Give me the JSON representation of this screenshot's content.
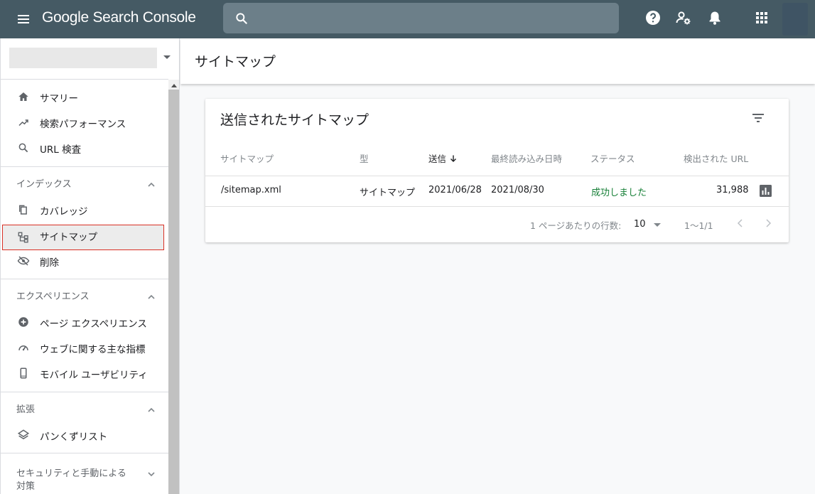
{
  "app": {
    "brand": "Google Search Console",
    "search_placeholder": ""
  },
  "sidebar": {
    "property_value": "",
    "items": [
      {
        "label": "サマリー",
        "icon": "home-icon"
      },
      {
        "label": "検索パフォーマンス",
        "icon": "trending-up-icon"
      },
      {
        "label": "URL 検査",
        "icon": "search-icon"
      }
    ],
    "sections": [
      {
        "title": "インデックス",
        "items": [
          {
            "label": "カバレッジ",
            "icon": "copy-icon"
          },
          {
            "label": "サイトマップ",
            "icon": "sitemap-icon",
            "active": true
          },
          {
            "label": "削除",
            "icon": "eye-off-icon"
          }
        ]
      },
      {
        "title": "エクスペリエンス",
        "items": [
          {
            "label": "ページ エクスペリエンス",
            "icon": "plus-circle-icon"
          },
          {
            "label": "ウェブに関する主な指標",
            "icon": "speed-gauge-icon"
          },
          {
            "label": "モバイル ユーザビリティ",
            "icon": "smartphone-icon"
          }
        ]
      },
      {
        "title": "拡張",
        "items": [
          {
            "label": "パンくずリスト",
            "icon": "layers-icon"
          }
        ]
      },
      {
        "title_line1": "セキュリティと手動による",
        "title_line2": "対策"
      }
    ]
  },
  "main": {
    "page_title": "サイトマップ",
    "card": {
      "title": "送信されたサイトマップ",
      "columns": [
        "サイトマップ",
        "型",
        "送信",
        "最終読み込み日時",
        "ステータス",
        "検出された URL"
      ],
      "rows": [
        {
          "sitemap": "/sitemap.xml",
          "type": "サイトマップ",
          "submitted": "2021/06/28",
          "last_read": "2021/08/30",
          "status": "成功しました",
          "discovered_urls": "31,988"
        }
      ],
      "footer": {
        "rows_per_page_label": "1 ページあたりの行数:",
        "rows_per_page": "10",
        "range": "1〜1/1"
      }
    }
  },
  "colors": {
    "topbar": "#455a64",
    "search_box": "#6c7f89",
    "status_ok": "#188038",
    "active_outline": "#d93025"
  }
}
